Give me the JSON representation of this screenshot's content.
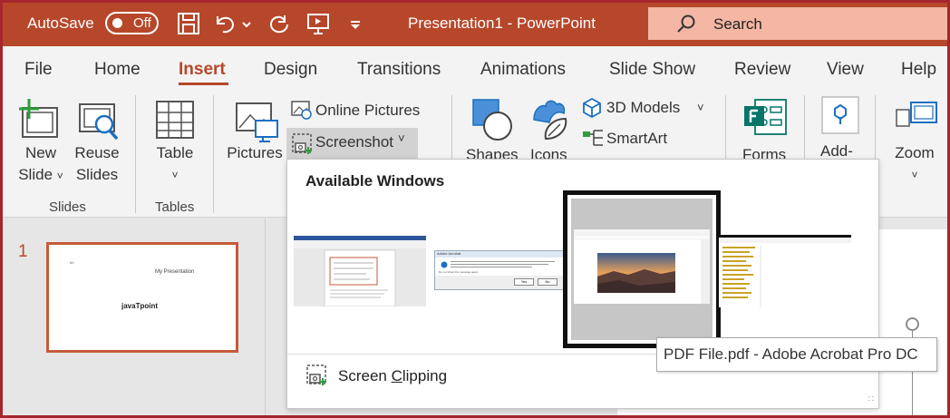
{
  "titlebar": {
    "autosave_label": "AutoSave",
    "autosave_state": "Off",
    "document_title": "Presentation1  -  PowerPoint",
    "search_label": "Search",
    "accent_color": "#b7472a"
  },
  "tabs": [
    {
      "label": "File"
    },
    {
      "label": "Home"
    },
    {
      "label": "Insert",
      "active": true
    },
    {
      "label": "Design"
    },
    {
      "label": "Transitions"
    },
    {
      "label": "Animations"
    },
    {
      "label": "Slide Show"
    },
    {
      "label": "Review"
    },
    {
      "label": "View"
    },
    {
      "label": "Help"
    }
  ],
  "ribbon": {
    "new_slide_line1": "New",
    "new_slide_line2": "Slide",
    "reuse_line1": "Reuse",
    "reuse_line2": "Slides",
    "slides_group": "Slides",
    "table": "Table",
    "tables_group": "Tables",
    "pictures": "Pictures",
    "online_pictures": "Online Pictures",
    "screenshot": "Screenshot",
    "shapes": "Shapes",
    "icons": "Icons",
    "models_3d": "3D Models",
    "smartart": "SmartArt",
    "forms": "Forms",
    "addins": "Add-",
    "zoom": "Zoom"
  },
  "slide_panel": {
    "slide_number": "1",
    "thumb_text_small": "hh",
    "thumb_title": "My Presentation",
    "thumb_logo": "javaTpoint"
  },
  "screenshot_menu": {
    "title": "Available Windows",
    "clip_prefix": "Screen ",
    "clip_accel": "C",
    "clip_suffix": "lipping",
    "dialog_title": "Adobe Acrobat",
    "dialog_checkbox": "Do not show this message again",
    "dialog_yes": "Yes",
    "dialog_no": "No"
  },
  "tooltip": {
    "text": "PDF File.pdf - Adobe Acrobat Pro DC"
  }
}
